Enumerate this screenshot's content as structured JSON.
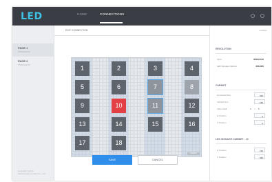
{
  "app": {
    "logo": "LED"
  },
  "topbar": {
    "tabs": [
      {
        "label": "HOME",
        "active": false
      },
      {
        "label": "CONNECTIONS",
        "active": true
      }
    ]
  },
  "sidebar": {
    "items": [
      {
        "title": "PAGE 1",
        "sub": "SIGNAGE 01"
      },
      {
        "title": "PAGE 2",
        "sub": "SIGNAGE 02"
      }
    ],
    "footer_line1": "Copyright ©2019",
    "footer_line2": "Samsung Electronics Co., Ltd."
  },
  "main": {
    "subbar_title": "EDIT CONNECTION",
    "tiles": [
      "1",
      "2",
      "3",
      "4",
      "5",
      "6",
      "7",
      "8",
      "9",
      "10",
      "11",
      "12",
      "13",
      "14",
      "15",
      "16",
      "17",
      "18"
    ],
    "corner_tag": "CABINET",
    "save_label": "SAVE",
    "cancel_label": "CANCEL"
  },
  "right": {
    "top_link": "Location",
    "resolution": {
      "heading": "RESOLUTION",
      "rows": [
        {
          "label": "Input",
          "value": "3840x2160"
        },
        {
          "label": "LED Signage Cabinet",
          "value": "320x360"
        }
      ]
    },
    "cabinet": {
      "heading": "CABINET",
      "rows": [
        {
          "label": "Horizontal Size",
          "value": "320"
        },
        {
          "label": "Vertical Size",
          "value": "180"
        },
        {
          "label": "Video Wall",
          "v1": "4",
          "v2": "5"
        },
        {
          "label": "H Position",
          "value": "0"
        },
        {
          "label": "V Position",
          "value": "0"
        }
      ]
    },
    "signage": {
      "heading": "LED SIGNAGE CABINET - 10",
      "rows": [
        {
          "label": "H Position",
          "value": "720"
        },
        {
          "label": "V Position",
          "value": "360"
        }
      ]
    }
  }
}
